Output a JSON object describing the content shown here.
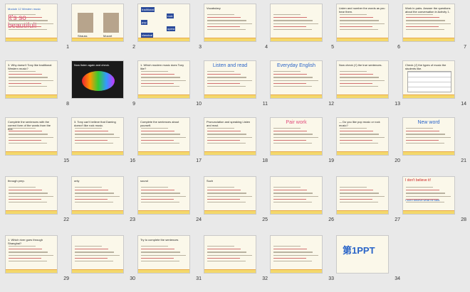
{
  "slides": [
    {
      "n": "1",
      "kind": "title",
      "title": "It's so beautiful!",
      "sub": "Module 12  Western music"
    },
    {
      "n": "2",
      "kind": "photos",
      "cap1": "Strauss",
      "cap2": "Mozart"
    },
    {
      "n": "3",
      "kind": "words",
      "words": [
        "traditional",
        "rock",
        "pop",
        "opera",
        "classical"
      ]
    },
    {
      "n": "4",
      "kind": "vocab",
      "title": "Vocabulary"
    },
    {
      "n": "5",
      "kind": "chinese"
    },
    {
      "n": "6",
      "kind": "listen",
      "title": "Listen and number the words as you hear them."
    },
    {
      "n": "7",
      "kind": "pair",
      "title": "Work in pairs. Answer the questions about the conversation in Activity 1."
    },
    {
      "n": "8",
      "kind": "questions",
      "title": "3. Why doesn't Tony like traditional Western music?"
    },
    {
      "n": "9",
      "kind": "color",
      "title": "Now listen again and check."
    },
    {
      "n": "10",
      "kind": "questions",
      "title": "1. Which modern music does Tony like?"
    },
    {
      "n": "11",
      "kind": "listenread",
      "title": "Listen and read"
    },
    {
      "n": "12",
      "kind": "english",
      "title": "Everyday English"
    },
    {
      "n": "13",
      "kind": "check",
      "title": "Now check (√) the true sentences."
    },
    {
      "n": "14",
      "kind": "table",
      "title": "Check (√) the types of music the students like."
    },
    {
      "n": "15",
      "kind": "complete",
      "title": "Complete the sentences with the correct form of the words from the box."
    },
    {
      "n": "16",
      "kind": "lines",
      "title": "3. Tony can't believe that Daming doesn't like rock music."
    },
    {
      "n": "17",
      "kind": "complete2",
      "title": "Complete the sentences about yourself."
    },
    {
      "n": "18",
      "kind": "pron",
      "title": "Pronunciation and speaking Listen and read."
    },
    {
      "n": "19",
      "kind": "pairwork",
      "title": "Pair work"
    },
    {
      "n": "20",
      "kind": "lines",
      "title": "— Do you like pop music or rock music?"
    },
    {
      "n": "21",
      "kind": "newword",
      "title": "New word"
    },
    {
      "n": "22",
      "kind": "lines",
      "title": "through prep."
    },
    {
      "n": "23",
      "kind": "lines",
      "title": "only"
    },
    {
      "n": "24",
      "kind": "lines",
      "title": "sound"
    },
    {
      "n": "25",
      "kind": "lines",
      "title": "Such"
    },
    {
      "n": "26",
      "kind": "lines",
      "title": ""
    },
    {
      "n": "27",
      "kind": "lines",
      "title": ""
    },
    {
      "n": "28",
      "kind": "believe",
      "title": "I don't believe it!",
      "sub": "I don't believe what he said."
    },
    {
      "n": "29",
      "kind": "lines",
      "title": "1. Which river goes through Shanghai?"
    },
    {
      "n": "30",
      "kind": "lines",
      "title": ""
    },
    {
      "n": "31",
      "kind": "lines",
      "title": "Try to complete the sentences"
    },
    {
      "n": "32",
      "kind": "lines",
      "title": ""
    },
    {
      "n": "33",
      "kind": "lines",
      "title": ""
    },
    {
      "n": "34",
      "kind": "logo",
      "title": "第1PPT"
    }
  ]
}
